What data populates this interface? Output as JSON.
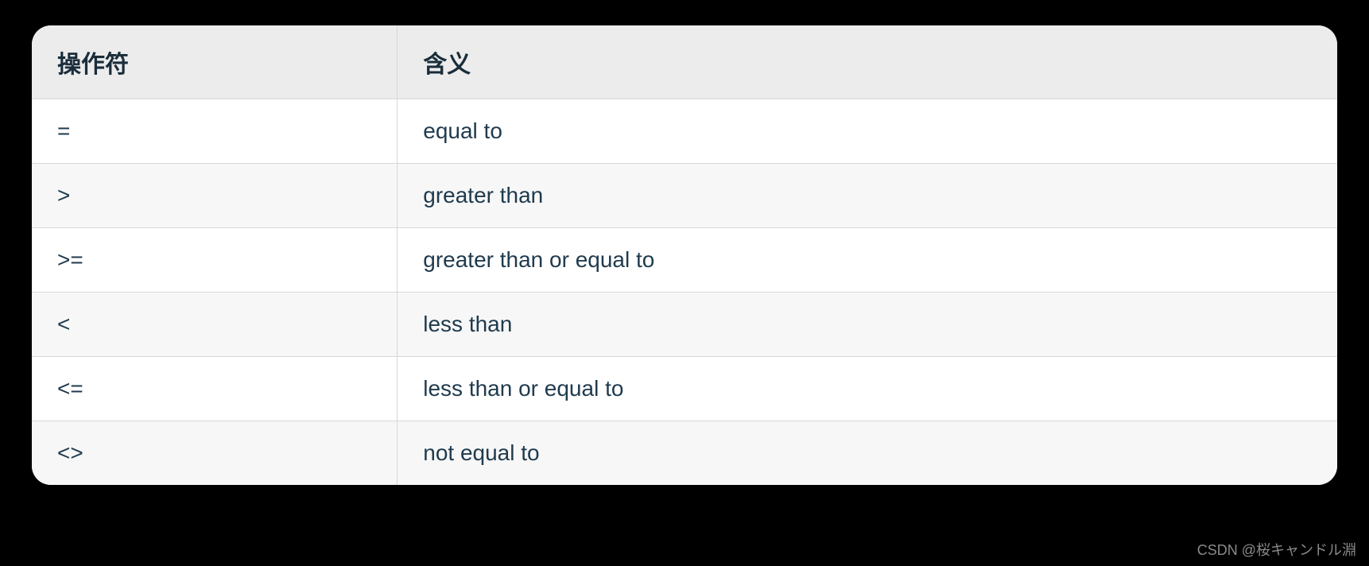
{
  "table": {
    "headers": {
      "operator": "操作符",
      "meaning": "含义"
    },
    "rows": [
      {
        "operator": "=",
        "meaning": "equal to"
      },
      {
        "operator": ">",
        "meaning": "greater than"
      },
      {
        "operator": ">=",
        "meaning": "greater than or equal to"
      },
      {
        "operator": "<",
        "meaning": "less than"
      },
      {
        "operator": "<=",
        "meaning": "less than or equal to"
      },
      {
        "operator": "<>",
        "meaning": "not equal to"
      }
    ]
  },
  "watermark": "CSDN @桜キャンドル淵"
}
